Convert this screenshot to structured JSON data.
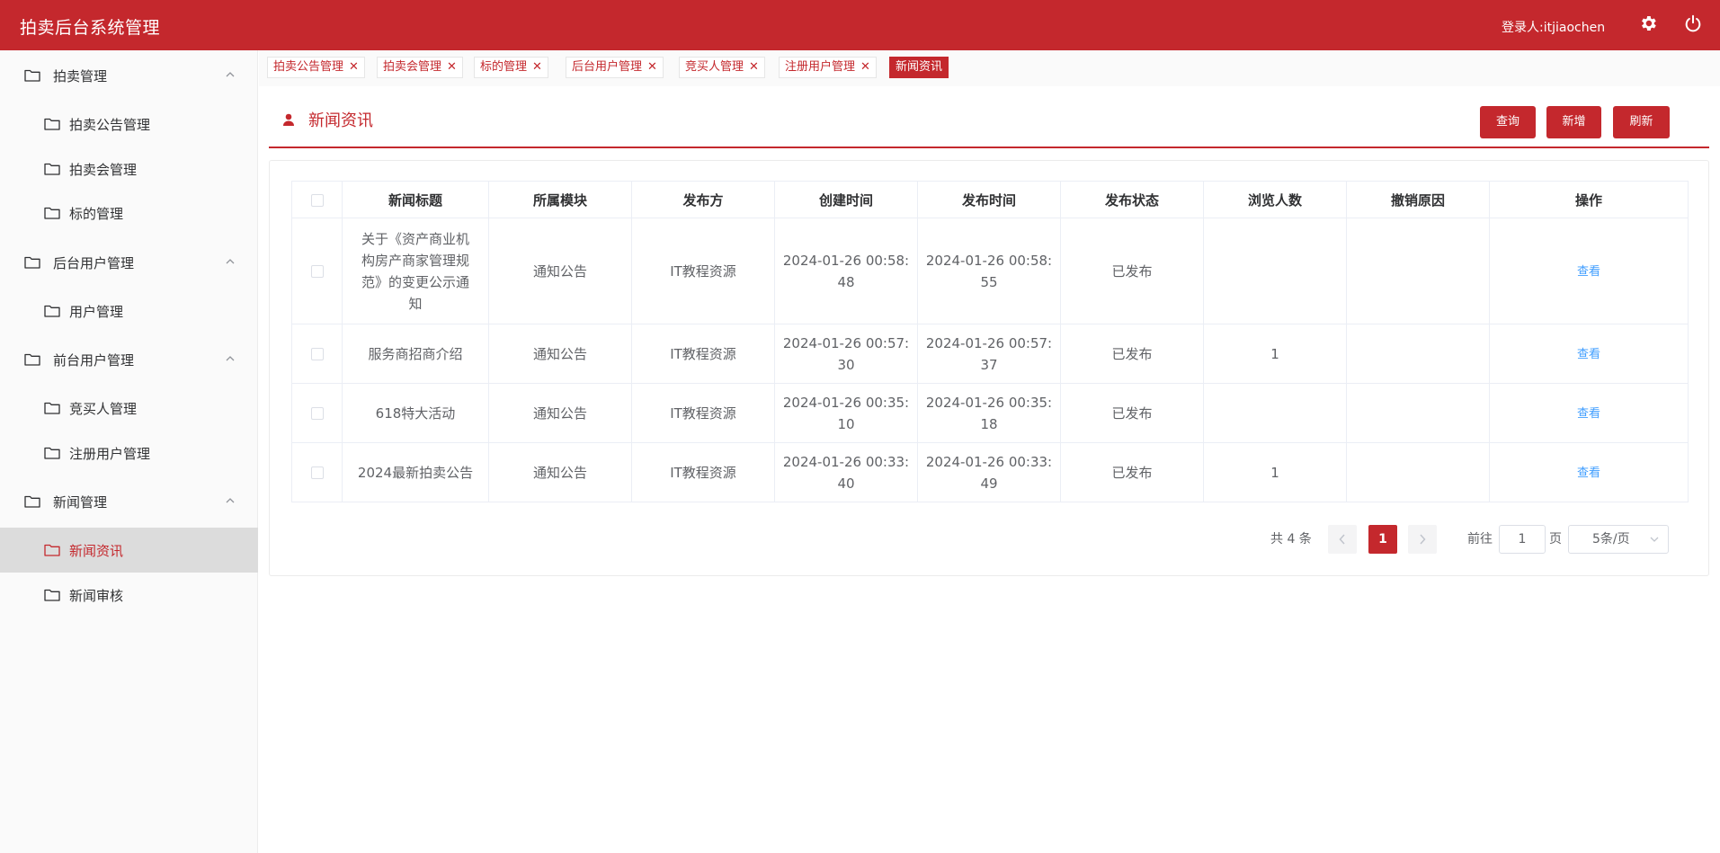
{
  "header": {
    "title": "拍卖后台系统管理",
    "user": "登录人:itjiaochen",
    "bg_color": "#c4282d"
  },
  "sidebar": {
    "groups": [
      {
        "label": "拍卖管理",
        "items": [
          "拍卖公告管理",
          "拍卖会管理",
          "标的管理"
        ]
      },
      {
        "label": "后台用户管理",
        "items": [
          "用户管理"
        ]
      },
      {
        "label": "前台用户管理",
        "items": [
          "竞买人管理",
          "注册用户管理"
        ]
      },
      {
        "label": "新闻管理",
        "items": [
          "新闻资讯",
          "新闻审核"
        ]
      }
    ],
    "active_item": "新闻资讯"
  },
  "tabs": [
    {
      "label": "拍卖公告管理",
      "active": false
    },
    {
      "label": "拍卖会管理",
      "active": false
    },
    {
      "label": "标的管理",
      "active": false
    },
    {
      "label": "后台用户管理",
      "active": false
    },
    {
      "label": "竞买人管理",
      "active": false
    },
    {
      "label": "注册用户管理",
      "active": false
    },
    {
      "label": "新闻资讯",
      "active": true
    }
  ],
  "page": {
    "title": "新闻资讯",
    "buttons": {
      "query": "查询",
      "add": "新增",
      "refresh": "刷新"
    }
  },
  "table": {
    "columns": [
      "新闻标题",
      "所属模块",
      "发布方",
      "创建时间",
      "发布时间",
      "发布状态",
      "浏览人数",
      "撤销原因",
      "操作"
    ],
    "rows": [
      {
        "title_lines": [
          "关于《资产商业机",
          "构房产商家管理规",
          "范》的变更公示通",
          "知"
        ],
        "module": "通知公告",
        "publisher": "IT教程资源",
        "created_lines": [
          "2024-01-26 00:58:",
          "48"
        ],
        "published_lines": [
          "2024-01-26 00:58:",
          "55"
        ],
        "status": "已发布",
        "views": "",
        "reason": "",
        "action": "查看"
      },
      {
        "title_lines": [
          "服务商招商介绍"
        ],
        "module": "通知公告",
        "publisher": "IT教程资源",
        "created_lines": [
          "2024-01-26 00:57:",
          "30"
        ],
        "published_lines": [
          "2024-01-26 00:57:",
          "37"
        ],
        "status": "已发布",
        "views": "1",
        "reason": "",
        "action": "查看"
      },
      {
        "title_lines": [
          "618特大活动"
        ],
        "module": "通知公告",
        "publisher": "IT教程资源",
        "created_lines": [
          "2024-01-26 00:35:",
          "10"
        ],
        "published_lines": [
          "2024-01-26 00:35:",
          "18"
        ],
        "status": "已发布",
        "views": "",
        "reason": "",
        "action": "查看"
      },
      {
        "title_lines": [
          "2024最新拍卖公告"
        ],
        "module": "通知公告",
        "publisher": "IT教程资源",
        "created_lines": [
          "2024-01-26 00:33:",
          "40"
        ],
        "published_lines": [
          "2024-01-26 00:33:",
          "49"
        ],
        "status": "已发布",
        "views": "1",
        "reason": "",
        "action": "查看"
      }
    ]
  },
  "pagination": {
    "total": "共 4 条",
    "current": "1",
    "goto_prefix": "前往",
    "goto_value": "1",
    "goto_suffix": "页",
    "page_size": "5条/页"
  }
}
